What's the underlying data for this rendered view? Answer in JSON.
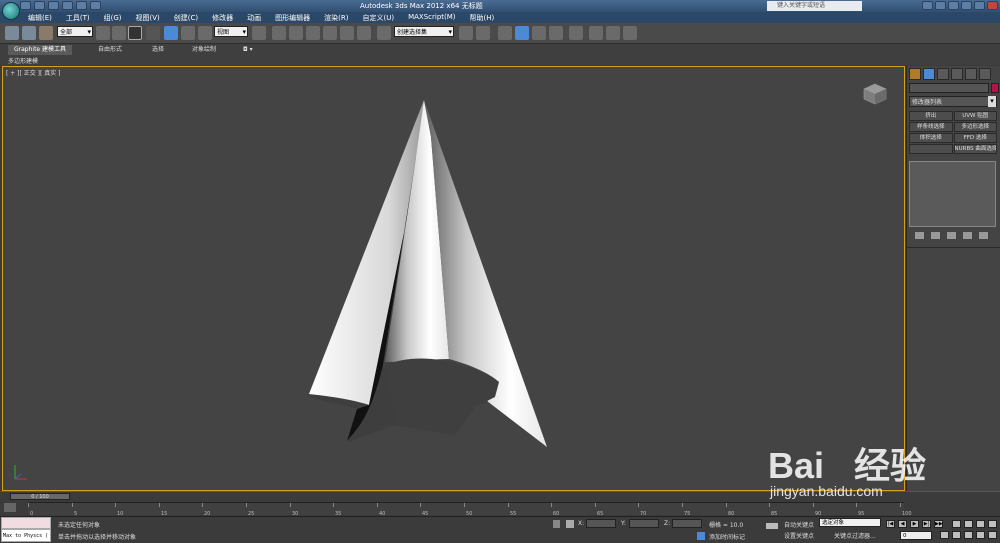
{
  "titlebar": {
    "title": "Autodesk 3ds Max  2012 x64      无标题",
    "search_placeholder": "键入关键字或短语"
  },
  "menubar": {
    "items": [
      "编辑(E)",
      "工具(T)",
      "组(G)",
      "视图(V)",
      "创建(C)",
      "修改器",
      "动画",
      "图形编辑器",
      "渲染(R)",
      "自定义(U)",
      "MAXScript(M)",
      "帮助(H)"
    ]
  },
  "toolbar": {
    "selection_filter": "全部",
    "ref_coord": "视图",
    "named_selection": "创建选择集"
  },
  "ribbon": {
    "tabs": [
      "Graphite 建模工具",
      "自由形式",
      "选择",
      "对象绘制"
    ],
    "sub_label": "多边形建模"
  },
  "viewport": {
    "label": "[ + ][ 正交 ][ 真实 ]"
  },
  "command_panel": {
    "modifier_list": "修改器列表",
    "buttons": [
      "挤出",
      "UVW 贴图",
      "样条线选择",
      "多边形选择",
      "体积选择",
      "FFD 选择",
      "",
      "NURBS 曲面选择"
    ]
  },
  "timeline": {
    "slider_text": "0 / 100",
    "ticks": [
      "0",
      "5",
      "10",
      "15",
      "20",
      "25",
      "30",
      "35",
      "40",
      "45",
      "50",
      "55",
      "60",
      "65",
      "70",
      "75",
      "80",
      "85",
      "90",
      "95",
      "100"
    ]
  },
  "statusbar": {
    "script_line1": "",
    "script_line2": "Max to Physcs (",
    "message_top": "未选定任何对象",
    "message_bottom": "单击并拖动以选择并移动对象",
    "x_label": "X:",
    "y_label": "Y:",
    "z_label": "Z:",
    "grid": "栅格 = 10.0",
    "add_time_tag": "添加时间标记",
    "auto_key": "自动关键点",
    "set_key": "设置关键点",
    "selected_object": "选定对象",
    "key_filters": "关键点过滤器...",
    "current_frame": "0"
  },
  "watermark": {
    "brand": "Bai",
    "brand2": "经验",
    "url": "jingyan.baidu.com"
  },
  "colors": {
    "viewport_border": "#d3a21a",
    "title_bg": "#3a5c82",
    "object_color": "#b3134a"
  }
}
